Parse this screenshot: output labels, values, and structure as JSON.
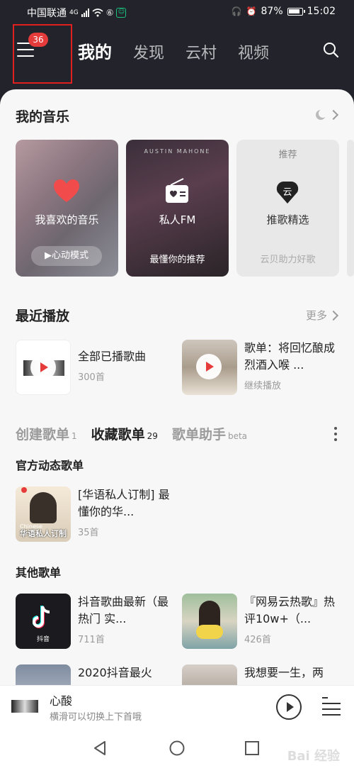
{
  "status": {
    "carrier": "中国联通",
    "network": "4G",
    "battery": "87%",
    "time": "15:02"
  },
  "header": {
    "badge_count": "36",
    "tabs": [
      {
        "label": "我的",
        "active": true
      },
      {
        "label": "发现",
        "active": false
      },
      {
        "label": "云村",
        "active": false
      },
      {
        "label": "视频",
        "active": false
      }
    ]
  },
  "my_music": {
    "title": "我的音乐",
    "cards": [
      {
        "title": "我喜欢的音乐",
        "sub": "▶心动模式"
      },
      {
        "title": "私人FM",
        "sub": "最懂你的推荐",
        "artist": "AUSTIN MAHONE"
      },
      {
        "top": "推荐",
        "title": "推歌精选",
        "sub": "云贝助力好歌"
      }
    ]
  },
  "recent": {
    "title": "最近播放",
    "more": "更多",
    "items": [
      {
        "title": "全部已播歌曲",
        "sub": "300首"
      },
      {
        "title": "歌单：将回忆酿成烈酒入喉 ...",
        "sub": "继续播放"
      }
    ]
  },
  "playlist_tabs": [
    {
      "label": "创建歌单",
      "count": "1",
      "active": false
    },
    {
      "label": "收藏歌单",
      "count": "29",
      "active": true
    },
    {
      "label": "歌单助手",
      "count": "beta",
      "active": false
    }
  ],
  "official": {
    "title": "官方动态歌单",
    "items": [
      {
        "title": "[华语私人订制] 最懂你的华...",
        "sub": "35首",
        "cover_text": "华语私人订制",
        "cover_en": "Chinese"
      }
    ]
  },
  "other": {
    "title": "其他歌单",
    "items": [
      {
        "title": "抖音歌曲最新（最热门 实...",
        "sub": "711首",
        "cover_text": "抖音"
      },
      {
        "title": "『网易云热歌』热评10w+（...",
        "sub": "426首"
      },
      {
        "title": "2020抖音最火",
        "sub": ""
      },
      {
        "title": "我想要一生，两",
        "sub": ""
      }
    ]
  },
  "player": {
    "title": "心酸",
    "sub": "横滑可以切换上下首哦"
  },
  "watermark": "Bai 经验",
  "colors": {
    "header_bg": "#23232b",
    "accent_red": "#e63b3b",
    "highlight_box": "#e02020"
  }
}
